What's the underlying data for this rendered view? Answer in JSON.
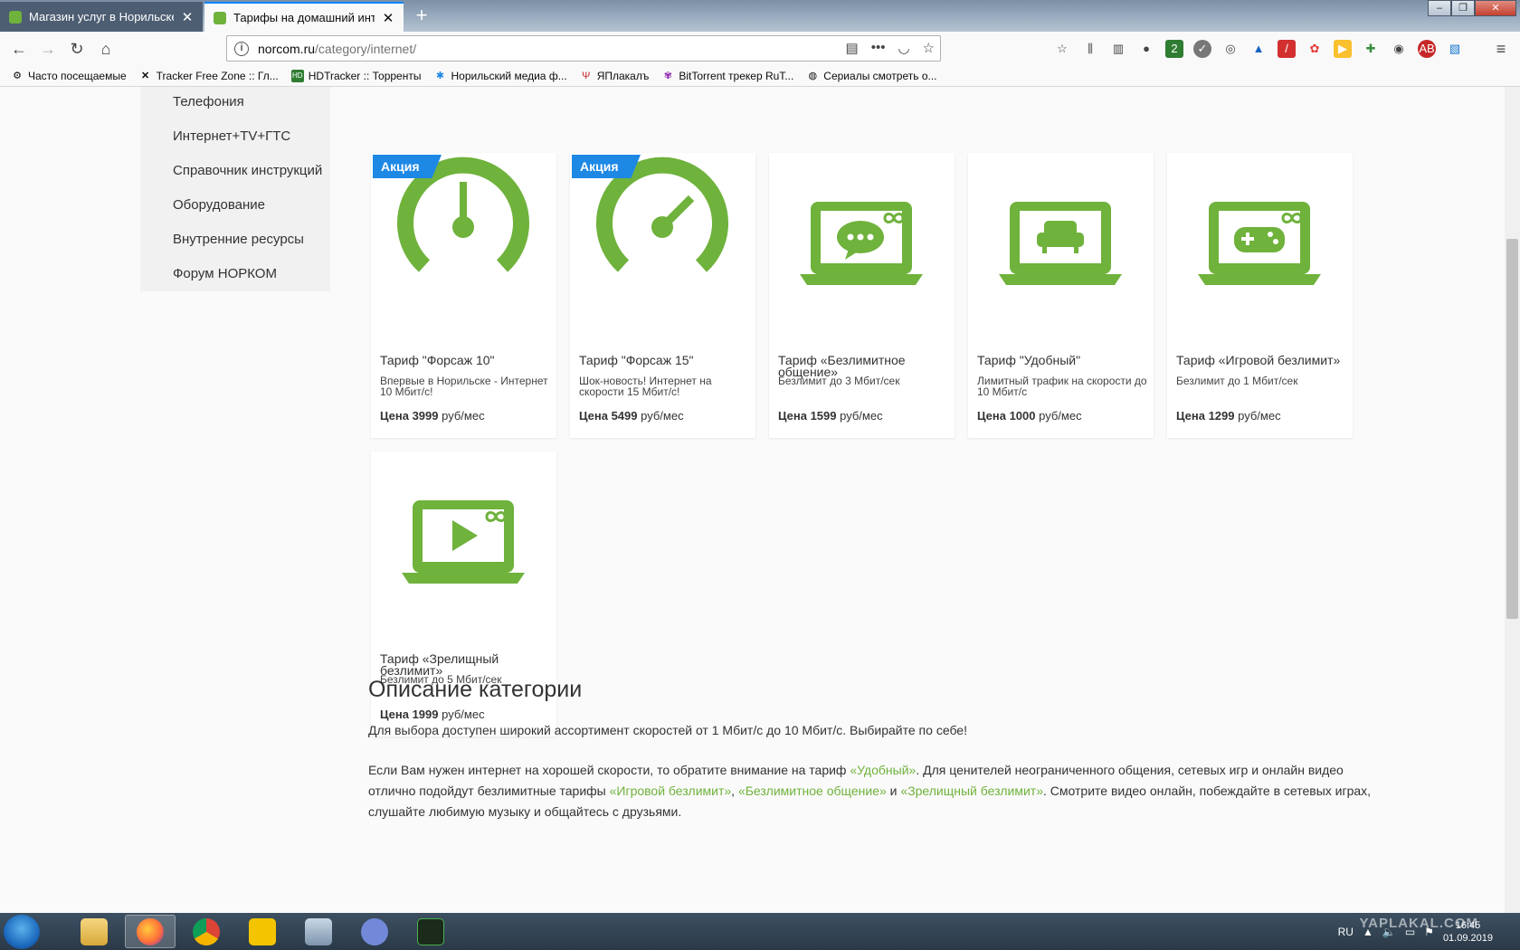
{
  "browser": {
    "tabs": [
      {
        "label": "Магазин услуг в Норильске -"
      },
      {
        "label": "Тарифы на домашний интер"
      }
    ],
    "url": {
      "host": "norcom.ru",
      "path": "/category/internet/"
    },
    "bookmarks": [
      {
        "label": "Часто посещаемые",
        "icon": "gear-icon"
      },
      {
        "label": "Tracker Free Zone :: Гл...",
        "icon": "x-icon"
      },
      {
        "label": "HDTracker :: Торренты",
        "icon": "hd-icon"
      },
      {
        "label": "Норильский медиа ф...",
        "icon": "snowflake-icon"
      },
      {
        "label": "ЯПлакалъ",
        "icon": "yap-icon"
      },
      {
        "label": "BitTorrent трекер RuT...",
        "icon": "rutracker-icon"
      },
      {
        "label": "Сериалы смотреть о...",
        "icon": "globe-icon"
      }
    ]
  },
  "sidebar": {
    "items": [
      {
        "label": "Телефония"
      },
      {
        "label": "Интернет+TV+ГТС"
      },
      {
        "label": "Справочник инструкций"
      },
      {
        "label": "Оборудование"
      },
      {
        "label": "Внутренние ресурсы"
      },
      {
        "label": "Форум НОРКОМ"
      }
    ]
  },
  "cards": [
    {
      "badge": "Акция",
      "icon": "speedometer-low-icon",
      "title": "Тариф \"Форсаж 10\"",
      "desc": "Впервые в Норильске - Интернет 10 Мбит/с!",
      "price_label": "Цена 3999",
      "price_unit": " руб/мес"
    },
    {
      "badge": "Акция",
      "icon": "speedometer-high-icon",
      "title": "Тариф \"Форсаж 15\"",
      "desc": "Шок-новость! Интернет на скорости 15 Мбит/с!",
      "price_label": "Цена 5499",
      "price_unit": " руб/мес"
    },
    {
      "badge": "",
      "icon": "laptop-chat-icon",
      "title": "Тариф «Безлимитное общение»",
      "desc": "Безлимит до 3 Мбит/сек",
      "price_label": "Цена 1599",
      "price_unit": " руб/мес"
    },
    {
      "badge": "",
      "icon": "laptop-armchair-icon",
      "title": "Тариф \"Удобный\"",
      "desc": "Лимитный трафик на скорости до 10 Мбит/с",
      "price_label": "Цена 1000",
      "price_unit": " руб/мес"
    },
    {
      "badge": "",
      "icon": "laptop-gamepad-icon",
      "title": "Тариф «Игровой безлимит»",
      "desc": "Безлимит до 1 Мбит/сек",
      "price_label": "Цена 1299",
      "price_unit": " руб/мес"
    },
    {
      "badge": "",
      "icon": "laptop-play-icon",
      "title": "Тариф «Зрелищный безлимит»",
      "desc": "Безлимит до 5 Мбит/сек",
      "price_label": "Цена 1999",
      "price_unit": " руб/мес"
    }
  ],
  "description": {
    "heading": "Описание категории",
    "p1": "Для выбора доступен широкий ассортимент скоростей от 1 Мбит/с до 10 Мбит/с. Выбирайте по себе!",
    "p2_a": "Если Вам нужен интернет на хорошей скорости, то обратите внимание на тариф ",
    "p2_link1": "«Удобный»",
    "p2_b": ". Для ценителей неограниченного общения, сетевых игр и онлайн видео отлично подойдут безлимитные тарифы ",
    "p2_link2": "«Игровой безлимит»",
    "p2_c": ", ",
    "p2_link3": "«Безлимитное общение»",
    "p2_d": " и ",
    "p2_link4": "«Зрелищный безлимит»",
    "p2_e": ". Смотрите видео онлайн, побеждайте в сетевых играх, слушайте любимую музыку и общайтесь с друзьями."
  },
  "taskbar": {
    "apps": [
      "explorer-icon",
      "firefox-icon",
      "chrome-icon",
      "player-icon",
      "servers-icon",
      "discord-icon",
      "terminal-icon"
    ],
    "lang": "RU",
    "time": "16:45",
    "date": "01.09.2019",
    "watermark": "YAPLAKAL.COM"
  },
  "colors": {
    "accent_green": "#6fb23c",
    "badge_blue": "#1e88e5",
    "tab_highlight": "#0a84ff"
  }
}
